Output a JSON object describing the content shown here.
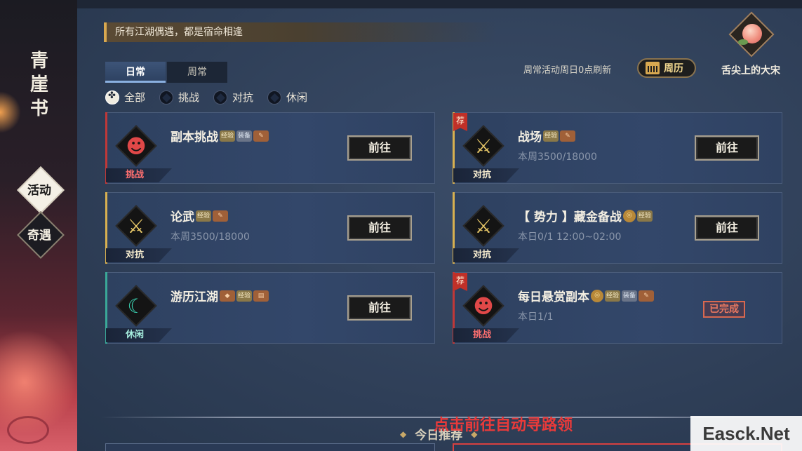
{
  "sidebar": {
    "book_title": "青崖书",
    "nav": [
      {
        "label": "活动",
        "active": true
      },
      {
        "label": "奇遇",
        "active": false
      }
    ]
  },
  "header": {
    "banner": "所有江湖偶遇，都是宿命相逢",
    "avatar_name": "舌尖上的大宋",
    "avatar_icon": "peach-icon",
    "refresh_note": "周常活动周日0点刷新",
    "calendar_button": "周历"
  },
  "tabs": [
    {
      "label": "日常",
      "active": true
    },
    {
      "label": "周常",
      "active": false
    }
  ],
  "filters": [
    {
      "label": "全部",
      "selected": true
    },
    {
      "label": "挑战",
      "selected": false
    },
    {
      "label": "对抗",
      "selected": false
    },
    {
      "label": "休闲",
      "selected": false
    }
  ],
  "cards": [
    {
      "title": "副本挑战",
      "sub": "",
      "type": "挑战",
      "recommended": false,
      "rewards": [
        "经验",
        "装备",
        "道具"
      ],
      "action": "前往",
      "done": false,
      "accent": "#c03838"
    },
    {
      "title": "战场",
      "sub": "本周3500/18000",
      "type": "对抗",
      "recommended": true,
      "rewards": [
        "经验",
        "道具"
      ],
      "action": "前往",
      "done": false,
      "accent": "#d8b050"
    },
    {
      "title": "论武",
      "sub": "本周3500/18000",
      "type": "对抗",
      "recommended": false,
      "rewards": [
        "经验",
        "道具"
      ],
      "action": "前往",
      "done": false,
      "accent": "#d8b050"
    },
    {
      "title": "【 势力 】藏金备战",
      "sub": "本日0/1  12:00~02:00",
      "type": "对抗",
      "recommended": false,
      "rewards": [
        "铜钱",
        "经验"
      ],
      "action": "前往",
      "done": false,
      "accent": "#d8b050"
    },
    {
      "title": "游历江湖",
      "sub": "",
      "type": "休闲",
      "recommended": false,
      "rewards": [
        "道具",
        "经验",
        "道具"
      ],
      "action": "前往",
      "done": false,
      "accent": "#3aa898"
    },
    {
      "title": "每日悬赏副本",
      "sub": "本日1/1",
      "type": "挑战",
      "recommended": true,
      "rewards": [
        "铜钱",
        "经验",
        "装备",
        "道具"
      ],
      "action": "",
      "done": true,
      "done_label": "已完成",
      "accent": "#c03838"
    }
  ],
  "rec_flag": "荐",
  "reward_labels": {
    "exp": "经验",
    "equip": "装备"
  },
  "today_recommend": "今日推荐",
  "overlay_hint": "点击前往自动寻路领",
  "watermark": "Easck.Net"
}
